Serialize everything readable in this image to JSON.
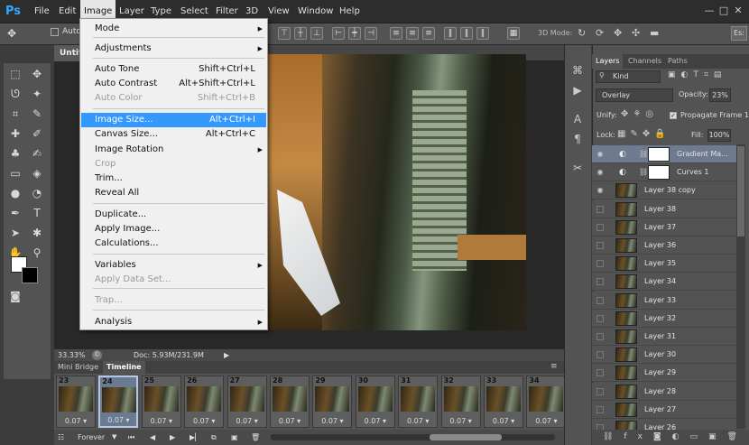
{
  "app": {
    "logo": "Ps"
  },
  "menubar": {
    "items": [
      "File",
      "Edit",
      "Image",
      "Layer",
      "Type",
      "Select",
      "Filter",
      "3D",
      "View",
      "Window",
      "Help"
    ],
    "active": "Image"
  },
  "window_controls": {
    "minimize": "—",
    "maximize": "□",
    "close": "✕"
  },
  "options_bar": {
    "auto_label": "Auto",
    "mode_3d_label": "3D Mode:",
    "essentials_label": "Es:"
  },
  "image_menu": {
    "items": [
      {
        "label": "Mode",
        "shortcut": "",
        "submenu": true,
        "disabled": false
      },
      {
        "label": "Adjustments",
        "shortcut": "",
        "submenu": true,
        "disabled": false
      },
      {
        "label": "Auto Tone",
        "shortcut": "Shift+Ctrl+L",
        "submenu": false,
        "disabled": false
      },
      {
        "label": "Auto Contrast",
        "shortcut": "Alt+Shift+Ctrl+L",
        "submenu": false,
        "disabled": false
      },
      {
        "label": "Auto Color",
        "shortcut": "Shift+Ctrl+B",
        "submenu": false,
        "disabled": true
      },
      {
        "label": "Image Size...",
        "shortcut": "Alt+Ctrl+I",
        "submenu": false,
        "disabled": false
      },
      {
        "label": "Canvas Size...",
        "shortcut": "Alt+Ctrl+C",
        "submenu": false,
        "disabled": false
      },
      {
        "label": "Image Rotation",
        "shortcut": "",
        "submenu": true,
        "disabled": false
      },
      {
        "label": "Crop",
        "shortcut": "",
        "submenu": false,
        "disabled": true
      },
      {
        "label": "Trim...",
        "shortcut": "",
        "submenu": false,
        "disabled": false
      },
      {
        "label": "Reveal All",
        "shortcut": "",
        "submenu": false,
        "disabled": false
      },
      {
        "label": "Duplicate...",
        "shortcut": "",
        "submenu": false,
        "disabled": false
      },
      {
        "label": "Apply Image...",
        "shortcut": "",
        "submenu": false,
        "disabled": false
      },
      {
        "label": "Calculations...",
        "shortcut": "",
        "submenu": false,
        "disabled": false
      },
      {
        "label": "Variables",
        "shortcut": "",
        "submenu": true,
        "disabled": false
      },
      {
        "label": "Apply Data Set...",
        "shortcut": "",
        "submenu": false,
        "disabled": true
      },
      {
        "label": "Trap...",
        "shortcut": "",
        "submenu": false,
        "disabled": true
      },
      {
        "label": "Analysis",
        "shortcut": "",
        "submenu": true,
        "disabled": false
      }
    ],
    "highlighted": "Image Size..."
  },
  "document": {
    "tab_label": "Untitl",
    "zoom": "33.33%",
    "doc_size": "Doc: 5.93M/231.9M"
  },
  "timeline": {
    "tabs": [
      "Mini Bridge",
      "Timeline"
    ],
    "active_tab": "Timeline",
    "frames": [
      {
        "num": "23",
        "delay": "0.07"
      },
      {
        "num": "24",
        "delay": "0.07"
      },
      {
        "num": "25",
        "delay": "0.07"
      },
      {
        "num": "26",
        "delay": "0.07"
      },
      {
        "num": "27",
        "delay": "0.07"
      },
      {
        "num": "28",
        "delay": "0.07"
      },
      {
        "num": "29",
        "delay": "0.07"
      },
      {
        "num": "30",
        "delay": "0.07"
      },
      {
        "num": "31",
        "delay": "0.07"
      },
      {
        "num": "32",
        "delay": "0.07"
      },
      {
        "num": "33",
        "delay": "0.07"
      },
      {
        "num": "34",
        "delay": "0.07"
      }
    ],
    "selected_frame": "24",
    "loop": "Forever"
  },
  "layers_panel": {
    "tabs": [
      "Layers",
      "Channels",
      "Paths"
    ],
    "active_tab": "Layers",
    "filter_kind": "Kind",
    "blend_mode": "Overlay",
    "opacity_label": "Opacity:",
    "opacity_value": "23%",
    "unify_label": "Unify:",
    "propagate_label": "Propagate Frame 1",
    "lock_label": "Lock:",
    "fill_label": "Fill:",
    "fill_value": "100%",
    "layers": [
      {
        "name": "Gradient Ma...",
        "type": "adjustment",
        "visible": true
      },
      {
        "name": "Curves 1",
        "type": "adjustment",
        "visible": true
      },
      {
        "name": "Layer 38 copy",
        "type": "pixel",
        "visible": true
      },
      {
        "name": "Layer 38",
        "type": "pixel",
        "visible": false
      },
      {
        "name": "Layer 37",
        "type": "pixel",
        "visible": false
      },
      {
        "name": "Layer 36",
        "type": "pixel",
        "visible": false
      },
      {
        "name": "Layer 35",
        "type": "pixel",
        "visible": false
      },
      {
        "name": "Layer 34",
        "type": "pixel",
        "visible": false
      },
      {
        "name": "Layer 33",
        "type": "pixel",
        "visible": false
      },
      {
        "name": "Layer 32",
        "type": "pixel",
        "visible": false
      },
      {
        "name": "Layer 31",
        "type": "pixel",
        "visible": false
      },
      {
        "name": "Layer 30",
        "type": "pixel",
        "visible": false
      },
      {
        "name": "Layer 29",
        "type": "pixel",
        "visible": false
      },
      {
        "name": "Layer 28",
        "type": "pixel",
        "visible": false
      },
      {
        "name": "Layer 27",
        "type": "pixel",
        "visible": false
      },
      {
        "name": "Layer 26",
        "type": "pixel",
        "visible": false
      }
    ],
    "selected_layer": "Gradient Ma..."
  },
  "colors": {
    "accent": "#3399ff",
    "selection": "#6d7a8f"
  }
}
